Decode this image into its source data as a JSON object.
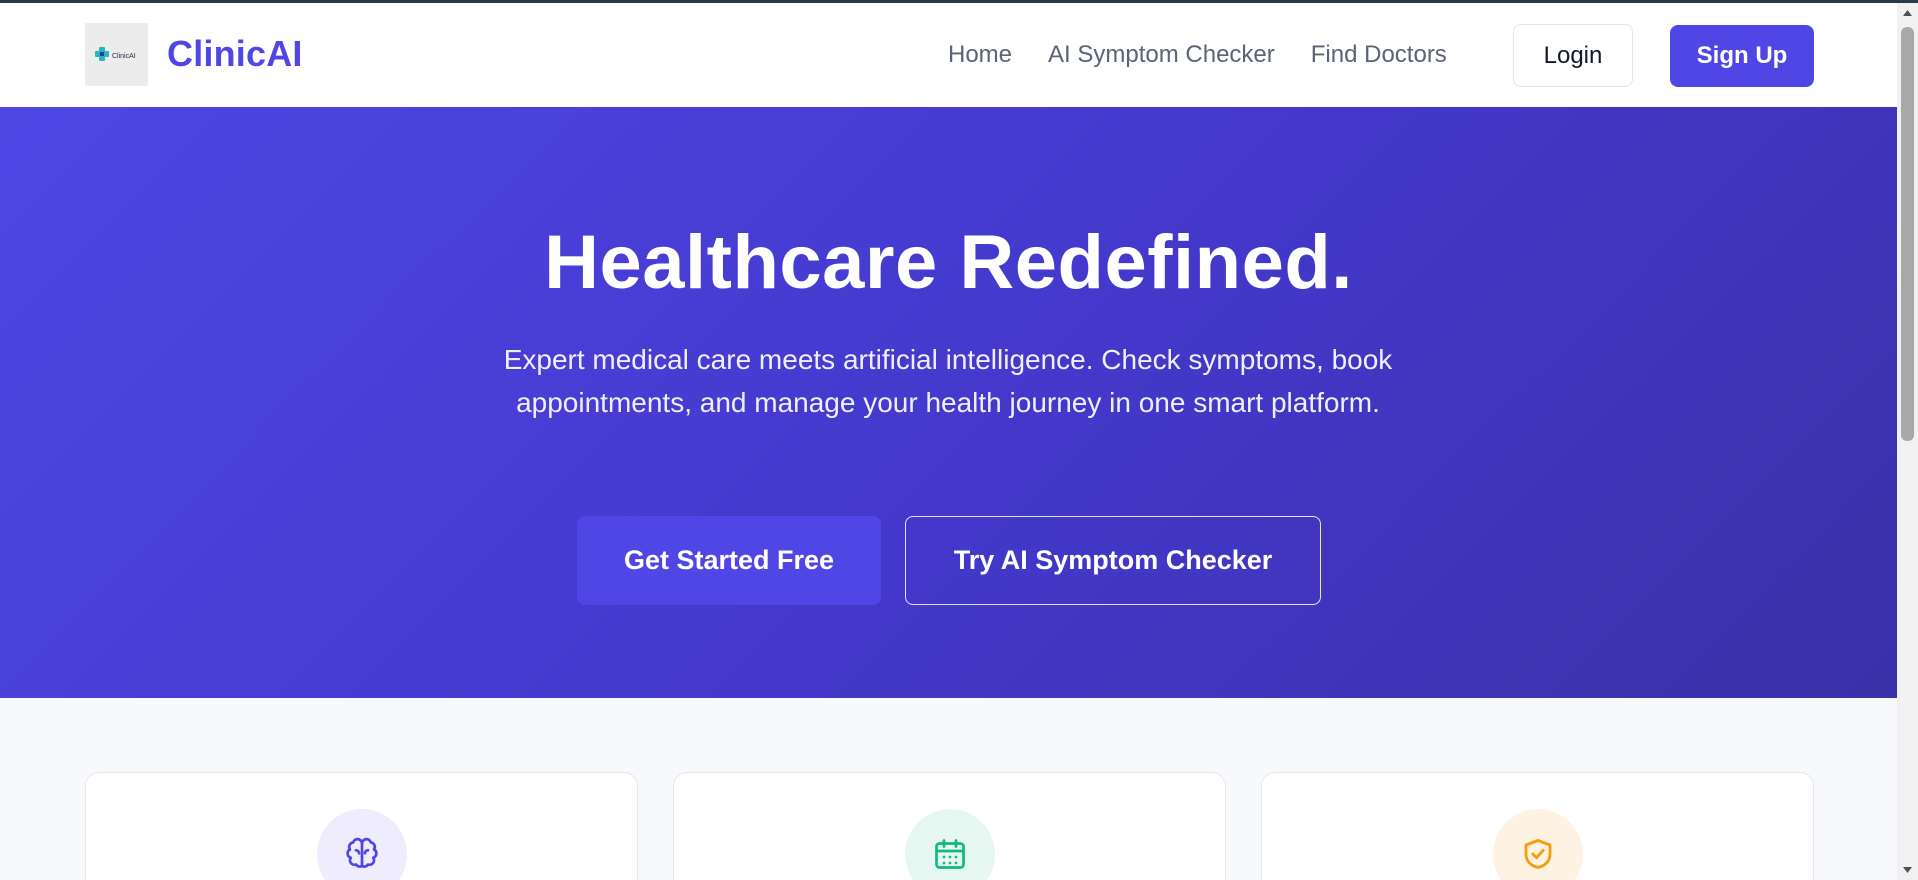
{
  "header": {
    "brand": "ClinicAI",
    "logo_text": "ClinicAI",
    "nav": [
      "Home",
      "AI Symptom Checker",
      "Find Doctors"
    ],
    "login_label": "Login",
    "signup_label": "Sign Up"
  },
  "hero": {
    "title": "Healthcare Redefined.",
    "subtitle": "Expert medical care meets artificial intelligence. Check symptoms, book appointments, and manage your health journey in one smart platform.",
    "primary_cta": "Get Started Free",
    "secondary_cta": "Try AI Symptom Checker"
  },
  "features": [
    {
      "icon": "brain-icon",
      "color": "#4f46e5",
      "bg": "#eeecfd"
    },
    {
      "icon": "calendar-icon",
      "color": "#10b981",
      "bg": "#e6f7f1"
    },
    {
      "icon": "shield-check-icon",
      "color": "#f59e0b",
      "bg": "#fef3e2"
    }
  ],
  "colors": {
    "brand": "#4f46e5",
    "hero_gradient_start": "#4f46e5",
    "hero_gradient_end": "#3a31a8"
  }
}
